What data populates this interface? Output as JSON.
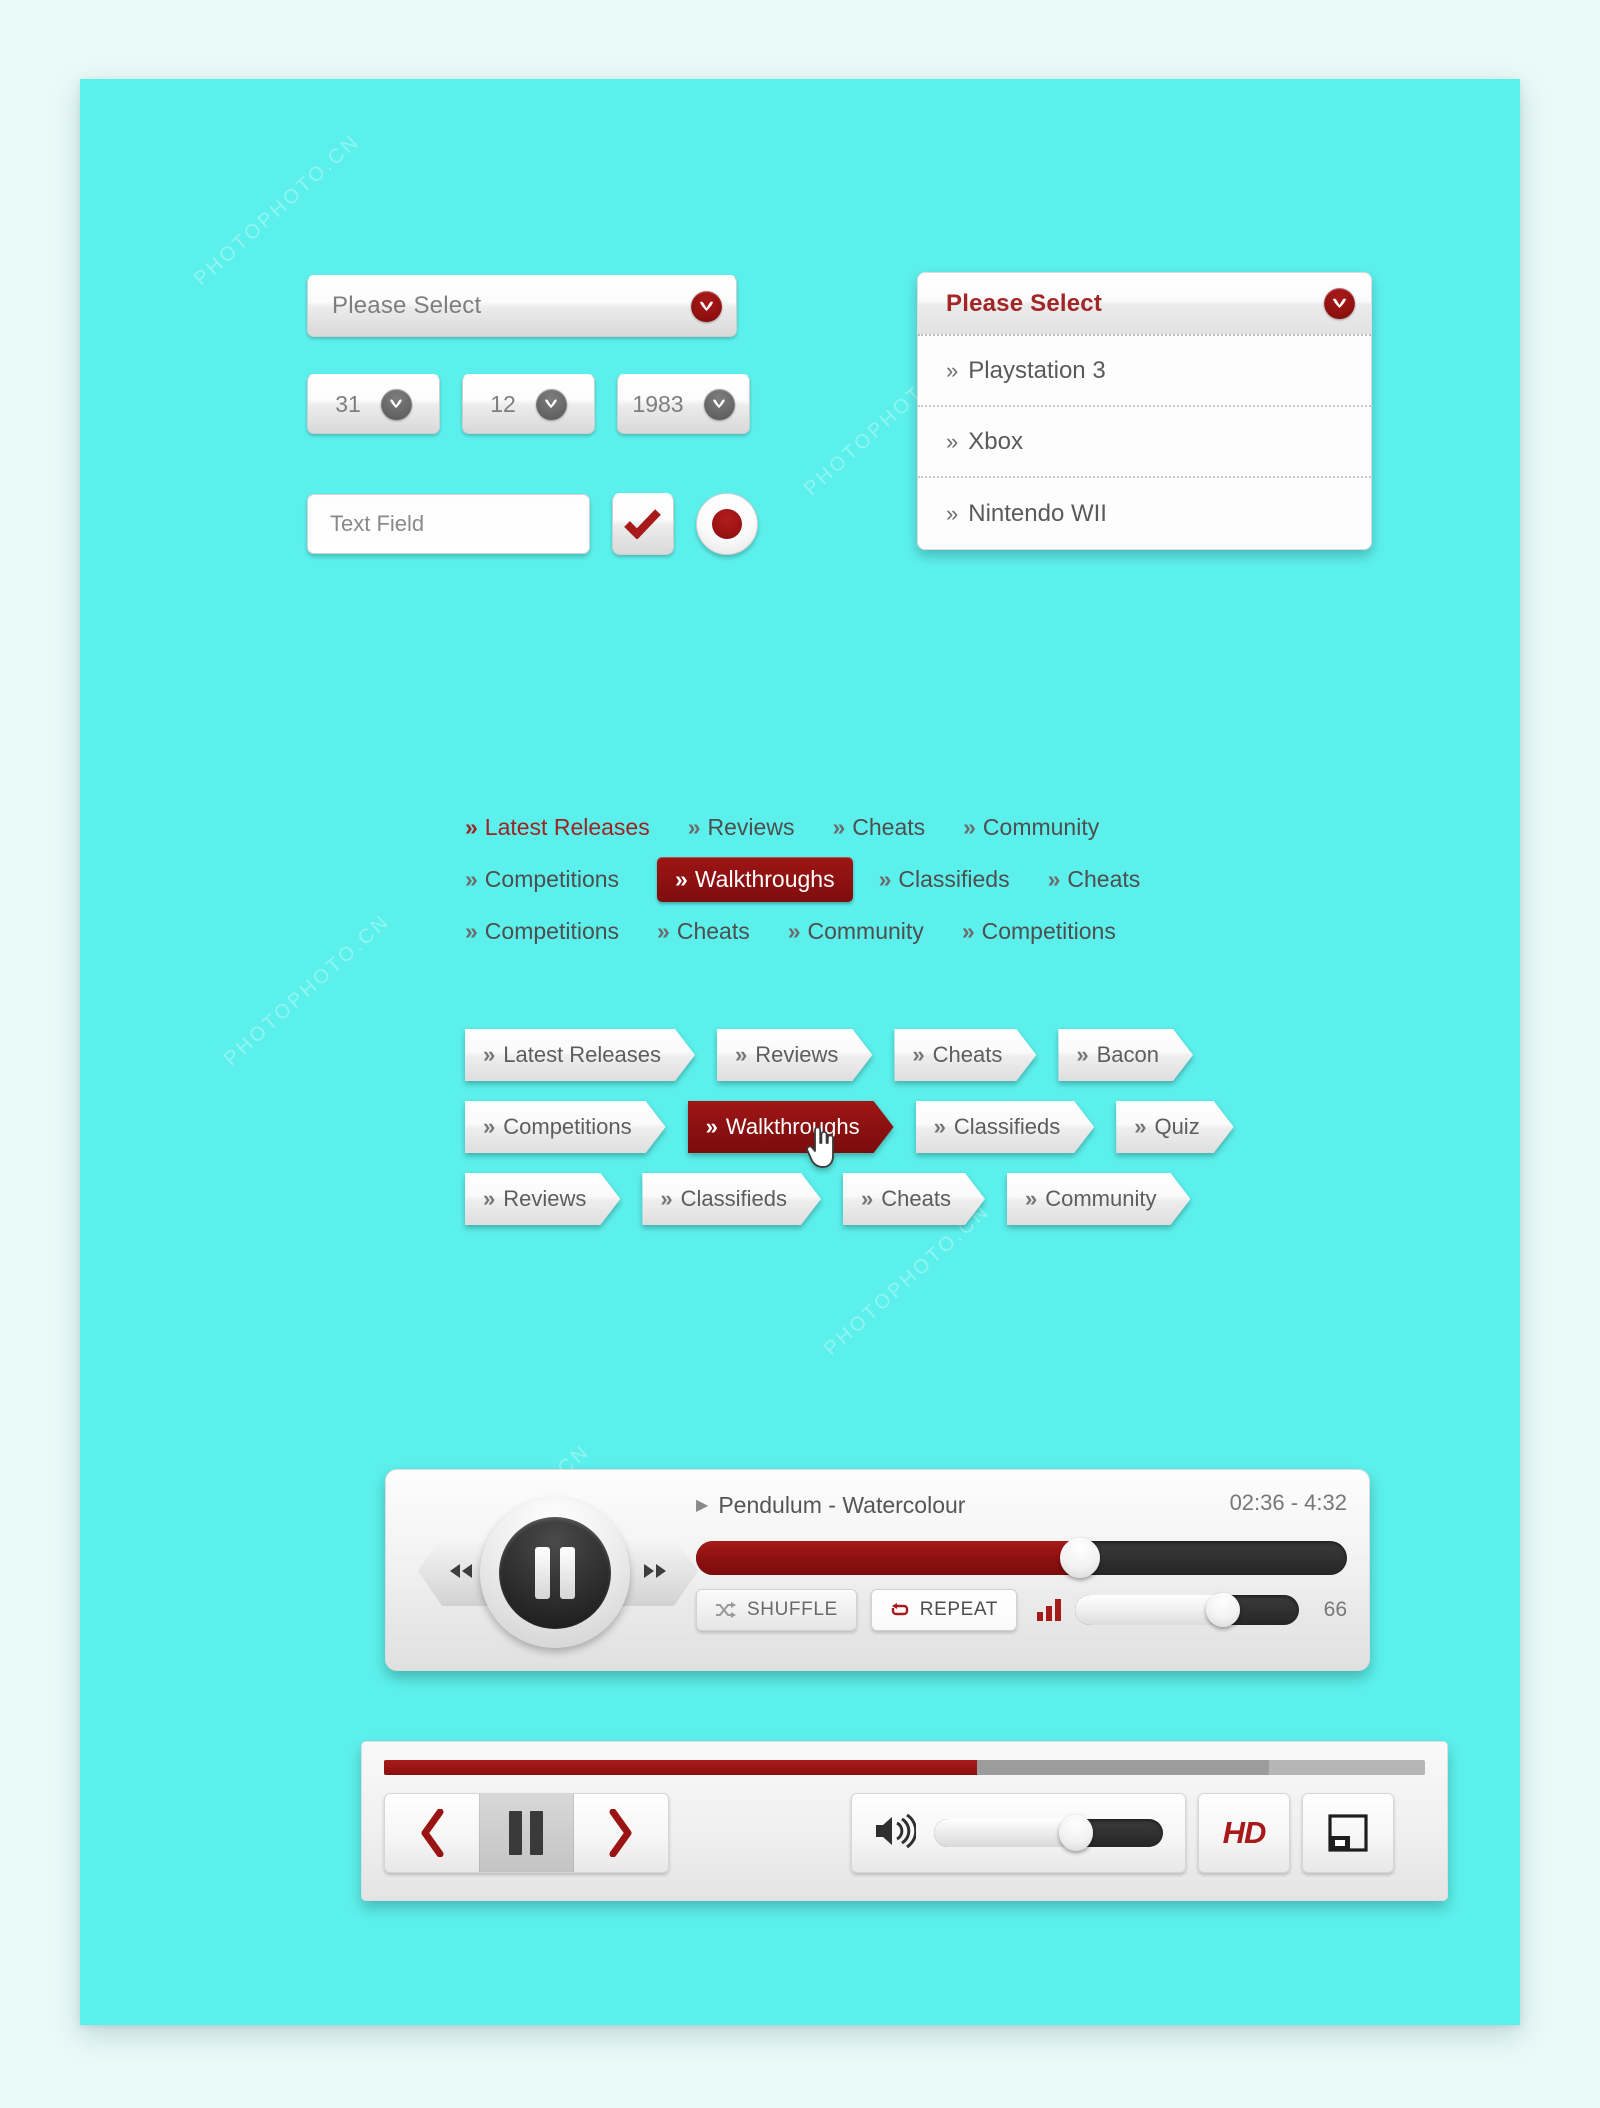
{
  "theme": {
    "page_bg": "#eafaf9",
    "canvas_bg": "#5cf0ec",
    "accent_red": "#a81a1a",
    "accent_dark_red": "#7e0d0d",
    "text_gray": "#5d5d5d"
  },
  "form": {
    "select_main": {
      "value": "Please Select",
      "icon": "chevron-down-circle-icon"
    },
    "date": {
      "day": {
        "value": "31",
        "icon": "chevron-down-circle-icon"
      },
      "month": {
        "value": "12",
        "icon": "chevron-down-circle-icon"
      },
      "year": {
        "value": "1983",
        "icon": "chevron-down-circle-icon"
      }
    },
    "text_field": {
      "placeholder": "Text Field",
      "value": ""
    },
    "checkbox": {
      "checked": true,
      "icon": "check-icon"
    },
    "radio": {
      "checked": true,
      "icon": "radio-dot-icon"
    }
  },
  "dropdown": {
    "header": {
      "label": "Please Select",
      "icon": "chevron-down-circle-icon"
    },
    "guillemet": "»",
    "items": [
      {
        "label": "Playstation 3"
      },
      {
        "label": "Xbox"
      },
      {
        "label": "Nintendo WII"
      }
    ]
  },
  "text_links": {
    "guillemet": "»",
    "rows": [
      [
        {
          "label": "Latest Releases",
          "state": "red"
        },
        {
          "label": "Reviews",
          "state": "normal"
        },
        {
          "label": "Cheats",
          "state": "normal"
        },
        {
          "label": "Community",
          "state": "normal"
        }
      ],
      [
        {
          "label": "Competitions",
          "state": "normal"
        },
        {
          "label": "Walkthroughs",
          "state": "active"
        },
        {
          "label": "Classifieds",
          "state": "normal"
        },
        {
          "label": "Cheats",
          "state": "normal"
        }
      ],
      [
        {
          "label": "Competitions",
          "state": "normal"
        },
        {
          "label": "Cheats",
          "state": "normal"
        },
        {
          "label": "Community",
          "state": "normal"
        },
        {
          "label": "Competitions",
          "state": "normal"
        }
      ]
    ]
  },
  "arrow_buttons": {
    "guillemet": "»",
    "rows": [
      [
        {
          "label": "Latest Releases",
          "state": "normal"
        },
        {
          "label": "Reviews",
          "state": "normal"
        },
        {
          "label": "Cheats",
          "state": "normal"
        },
        {
          "label": "Bacon",
          "state": "normal"
        }
      ],
      [
        {
          "label": "Competitions",
          "state": "normal"
        },
        {
          "label": "Walkthroughs",
          "state": "active",
          "cursor": "hand-cursor"
        },
        {
          "label": "Classifieds",
          "state": "normal"
        },
        {
          "label": "Quiz",
          "state": "normal"
        }
      ],
      [
        {
          "label": "Reviews",
          "state": "normal"
        },
        {
          "label": "Classifieds",
          "state": "normal"
        },
        {
          "label": "Cheats",
          "state": "normal"
        },
        {
          "label": "Community",
          "state": "normal"
        }
      ]
    ]
  },
  "music_player": {
    "transport": {
      "prev_icon": "rewind-icon",
      "play_pause_icon": "pause-icon",
      "next_icon": "fast-forward-icon"
    },
    "track_title": "Pendulum - Watercolour",
    "track_title_icon": "play-triangle-icon",
    "time": "02:36 - 4:32",
    "progress_percent": 59,
    "shuffle": {
      "label": "SHUFFLE",
      "icon": "shuffle-icon",
      "active": false
    },
    "repeat": {
      "label": "REPEAT",
      "icon": "repeat-icon",
      "active": true
    },
    "volume_icon": "volume-bars-icon",
    "volume_value": "66",
    "volume_percent": 66
  },
  "video_player": {
    "progress_played_percent": 57,
    "progress_buffered_percent": 85,
    "prev_icon": "chevron-left-icon",
    "play_pause_icon": "pause-icon",
    "next_icon": "chevron-right-icon",
    "volume_icon": "speaker-icon",
    "volume_percent": 62,
    "hd_label": "HD",
    "fullscreen_icon": "screen-layout-icon"
  }
}
